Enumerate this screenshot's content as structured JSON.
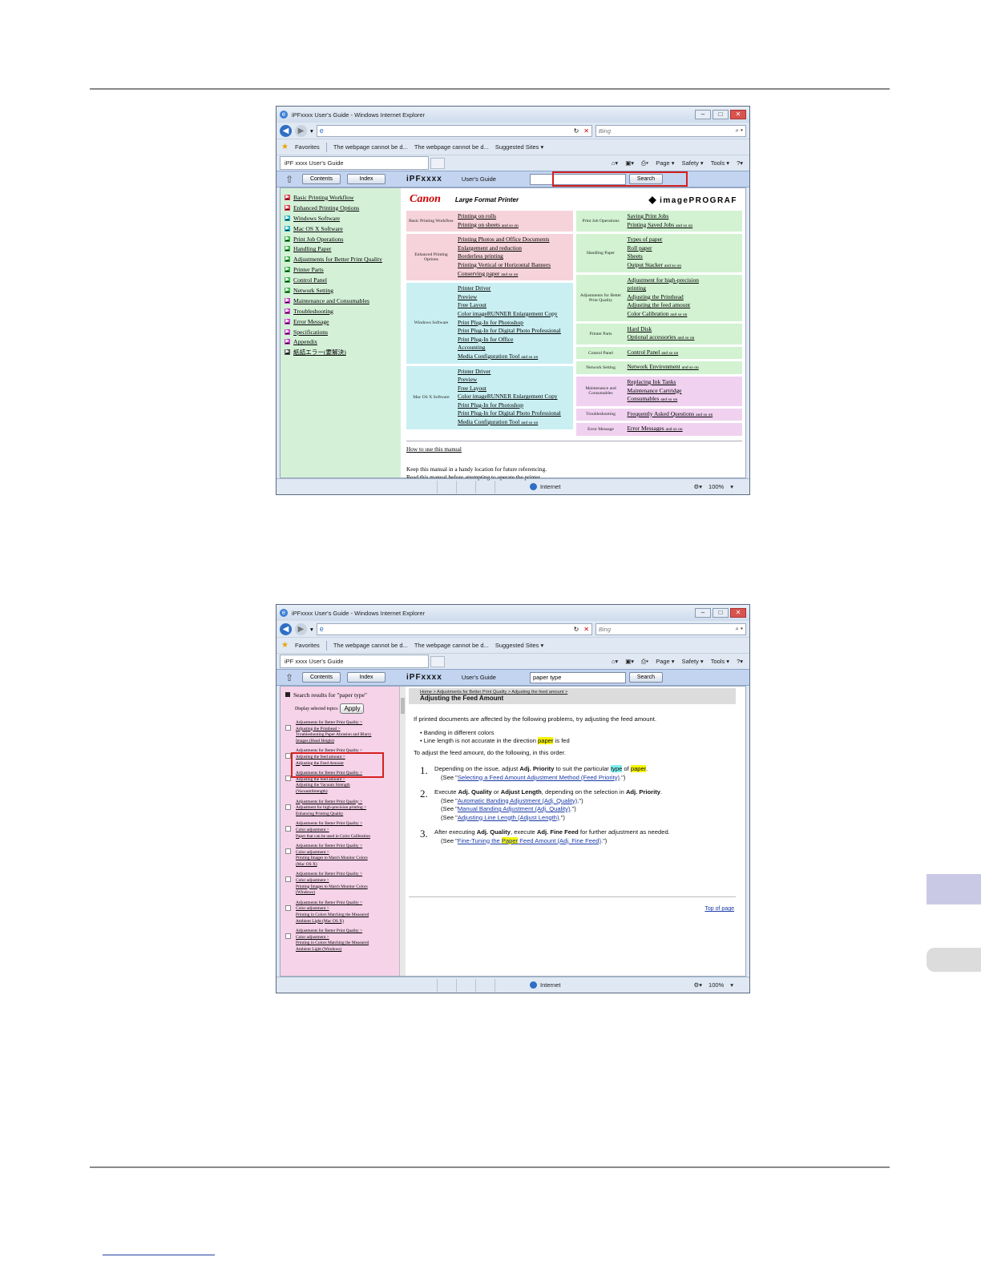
{
  "window": {
    "title": "iPFxxxx User's Guide - Windows Internet Explorer",
    "search_placeholder": "Bing",
    "fav_label": "Favorites",
    "fav_items": [
      "The webpage cannot be d...",
      "The webpage cannot be d..."
    ],
    "suggested": "Suggested Sites ▾",
    "tab_title": "iPF xxxx User's Guide",
    "cmd_page": "Page ▾",
    "cmd_safety": "Safety ▾",
    "cmd_tools": "Tools ▾",
    "status_internet": "Internet",
    "status_zoom": "100%"
  },
  "pagehead": {
    "contents": "Contents",
    "index": "Index",
    "brand": "iPFxxxx",
    "users_guide": "User's Guide",
    "search_btn": "Search",
    "search_value_2": "paper type"
  },
  "nav1": {
    "items": [
      {
        "label": "Basic Printing Workflow",
        "color": "#e8384f"
      },
      {
        "label": "Enhanced Printing Options",
        "color": "#e8384f"
      },
      {
        "label": "Windows Software",
        "color": "#1fb5c4"
      },
      {
        "label": "Mac OS X Software",
        "color": "#1fb5c4"
      },
      {
        "label": "Print Job Operations",
        "color": "#39b54a"
      },
      {
        "label": "Handling Paper",
        "color": "#39b54a"
      },
      {
        "label": "Adjustments for Better Print Quality",
        "color": "#39b54a"
      },
      {
        "label": "Printer Parts",
        "color": "#39b54a"
      },
      {
        "label": "Control Panel",
        "color": "#39b54a"
      },
      {
        "label": "Network Setting",
        "color": "#39b54a"
      },
      {
        "label": "Maintenance and Consumables",
        "color": "#cc3ccc"
      },
      {
        "label": "Troubleshooting",
        "color": "#cc3ccc"
      },
      {
        "label": "Error Message",
        "color": "#cc3ccc"
      },
      {
        "label": "Specifications",
        "color": "#cc3ccc"
      },
      {
        "label": "Appendix",
        "color": "#cc3ccc"
      },
      {
        "label": "紙詰エラー(要解決)",
        "color": "#555555"
      }
    ]
  },
  "main1": {
    "logo": "Canon",
    "tagline": "Large Format Printer",
    "brand": "imagePROGRAF",
    "blocks_left": [
      {
        "label": "Basic Printing Workflow",
        "cls": "pink",
        "links": [
          "Printing on rolls",
          "Printing on sheets"
        ]
      },
      {
        "label": "Enhanced Printing Options",
        "cls": "pink",
        "links": [
          "Printing Photos and Office Documents",
          "Enlargement and reduction",
          "Borderless printing",
          "Printing Vertical or Horizontal Banners",
          "Conserving paper"
        ]
      },
      {
        "label": "Windows Software",
        "cls": "cyan",
        "links": [
          "Printer Driver",
          "Preview",
          "Free Layout",
          "Color imageRUNNER Enlargement Copy",
          "Print Plug-In for Photoshop",
          "Print Plug-In for Digital Photo Professional",
          "Print Plug-In for Office",
          "Accounting",
          "Media Configuration Tool"
        ]
      },
      {
        "label": "Mac OS X Software",
        "cls": "cyan",
        "links": [
          "Printer Driver",
          "Preview",
          "Free Layout",
          "Color imageRUNNER Enlargement Copy",
          "Print Plug-In for Photoshop",
          "Print Plug-In for Digital Photo Professional",
          "Media Configuration Tool"
        ]
      }
    ],
    "blocks_right": [
      {
        "label": "Print Job Operations",
        "cls": "green",
        "links": [
          "Saving Print Jobs",
          "Printing Saved Jobs"
        ]
      },
      {
        "label": "Handling Paper",
        "cls": "green",
        "links": [
          "Types of paper",
          "Roll paper",
          "Sheets",
          "Output Stacker"
        ]
      },
      {
        "label": "Adjustments for Better Print Quality",
        "cls": "green",
        "links": [
          "Adjustment for high-precision",
          "printing",
          "Adjusting the Printhead",
          "Adjusting the feed amount",
          "Color Calibration"
        ]
      },
      {
        "label": "Printer Parts",
        "cls": "green",
        "links": [
          "Hard Disk",
          "Optional accessories"
        ]
      },
      {
        "label": "Control Panel",
        "cls": "green",
        "links": [
          "Control Panel"
        ]
      },
      {
        "label": "Network Setting",
        "cls": "green",
        "links": [
          "Network Environment"
        ]
      },
      {
        "label": "Maintenance and Consumables",
        "cls": "mag",
        "links": [
          "Replacing Ink Tanks",
          "Maintenance Cartridge",
          "Consumables"
        ]
      },
      {
        "label": "Troubleshooting",
        "cls": "mag",
        "links": [
          "Frequently Asked Questions"
        ]
      },
      {
        "label": "Error Message",
        "cls": "mag",
        "links": [
          "Error Messages"
        ]
      }
    ],
    "and_so_on": "and so on",
    "how_to": "How to use this manual",
    "note1": "Keep this manual in a handy location for future referencing.",
    "note2": "Read this manual before attempting to operate the printer."
  },
  "search2": {
    "heading": "Search results for \"paper type\"",
    "display": "Display selected topics",
    "apply": "Apply",
    "results": [
      [
        "Adjustments for Better Print Quality >",
        "Adjusting the Printhead >",
        "Troubleshooting Paper Abrasion and Blurry",
        "Images (Head Height)"
      ],
      [
        "Adjustments for Better Print Quality >",
        "Adjusting the feed amount >",
        "Adjusting the Feed Amount"
      ],
      [
        "Adjustments for Better Print Quality >",
        "Adjusting the feed amount >",
        "Adjusting the Vacuum Strength",
        "(VacuumStrength)"
      ],
      [
        "Adjustments for Better Print Quality >",
        "Adjustment for high-precision printing >",
        "Enhancing Printing Quality"
      ],
      [
        "Adjustments for Better Print Quality >",
        "Color adjustment >",
        "Paper that can be used in Color Calibration"
      ],
      [
        "Adjustments for Better Print Quality >",
        "Color adjustment >",
        "Printing Images to Match Monitor Colors",
        "(Mac OS X)"
      ],
      [
        "Adjustments for Better Print Quality >",
        "Color adjustment >",
        "Printing Images to Match Monitor Colors",
        "(Windows)"
      ],
      [
        "Adjustments for Better Print Quality >",
        "Color adjustment >",
        "Printing in Colors Matching the Measured",
        "Ambient Light (Mac OS X)"
      ],
      [
        "Adjustments for Better Print Quality >",
        "Color adjustment >",
        "Printing in Colors Matching the Measured",
        "Ambient Light (Windows)"
      ]
    ]
  },
  "topic2": {
    "crumb": "Home > Adjustments for Better Print Quality > Adjusting the feed amount >",
    "title": "Adjusting the Feed Amount",
    "intro": "If printed documents are affected by the following problems, try adjusting the feed amount.",
    "bullet1": "Banding in different colors",
    "bullet2a": "Line length is not accurate in the direction ",
    "bullet2_hl": "paper",
    "bullet2b": " is fed",
    "todo": "To adjust the feed amount, do the following, in this order.",
    "s1_n": "1.",
    "s1a": "Depending on the issue, adjust ",
    "s1_b": "Adj. Priority",
    "s1b": " to suit the particular ",
    "s1_type": "type",
    "s1_of": " of ",
    "s1_paper": "paper",
    "s1_end": ".",
    "s1_see_pre": "(See \"",
    "s1_link": "Selecting a Feed Amount Adjustment Method (Feed Priority)",
    "s1_see_post": ".\")",
    "s2_n": "2.",
    "s2a": "Execute ",
    "s2_b1": "Adj. Quality",
    "s2_or": " or ",
    "s2_b2": "Adjust Length",
    "s2b": ", depending on the selection in ",
    "s2_b3": "Adj. Priority",
    "s2_end": ".",
    "s2_l1": "Automatic Banding Adjustment (Adj. Quality)",
    "s2_l2": "Manual Banding Adjustment (Adj. Quality)",
    "s2_l3": "Adjusting Line Length (Adjust Length)",
    "s3_n": "3.",
    "s3a": "After executing ",
    "s3_b1": "Adj. Quality",
    "s3b": ", execute ",
    "s3_b2": "Adj. Fine Feed",
    "s3c": " for further adjustment as needed.",
    "s3_l_a": "Fine-Tuning the ",
    "s3_l_hl": "Paper",
    "s3_l_b": " Feed Amount (Adj. Fine Feed)",
    "see_pre": "(See \"",
    "see_post": ".\")",
    "top": "Top of page"
  }
}
